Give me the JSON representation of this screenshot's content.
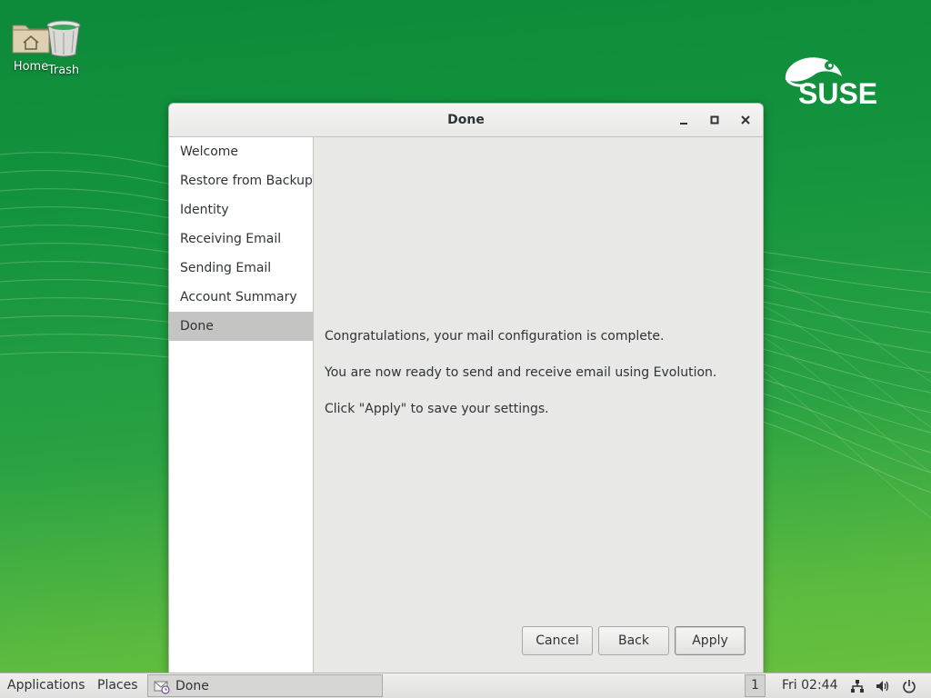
{
  "desktop": {
    "icons": [
      {
        "label": "Home"
      },
      {
        "label": "Trash"
      }
    ],
    "logo_text": "SUSE"
  },
  "window": {
    "title": "Done",
    "controls": {
      "minimize": "minimize",
      "maximize": "maximize",
      "close": "close"
    },
    "steps": [
      {
        "label": "Welcome"
      },
      {
        "label": "Restore from Backup"
      },
      {
        "label": "Identity"
      },
      {
        "label": "Receiving Email"
      },
      {
        "label": "Sending Email"
      },
      {
        "label": "Account Summary"
      },
      {
        "label": "Done",
        "active": true
      }
    ],
    "messages": [
      "Congratulations, your mail configuration is complete.",
      "You are now ready to send and receive email using Evolution.",
      "Click \"Apply\" to save your settings."
    ],
    "buttons": {
      "cancel": "Cancel",
      "back": "Back",
      "apply": "Apply"
    }
  },
  "taskbar": {
    "applications": "Applications",
    "places": "Places",
    "window_title": "Done",
    "workspace": "1",
    "clock": "Fri 02:44"
  },
  "colors": {
    "desktop_green": "#14943e",
    "logo": "#ffffff"
  }
}
